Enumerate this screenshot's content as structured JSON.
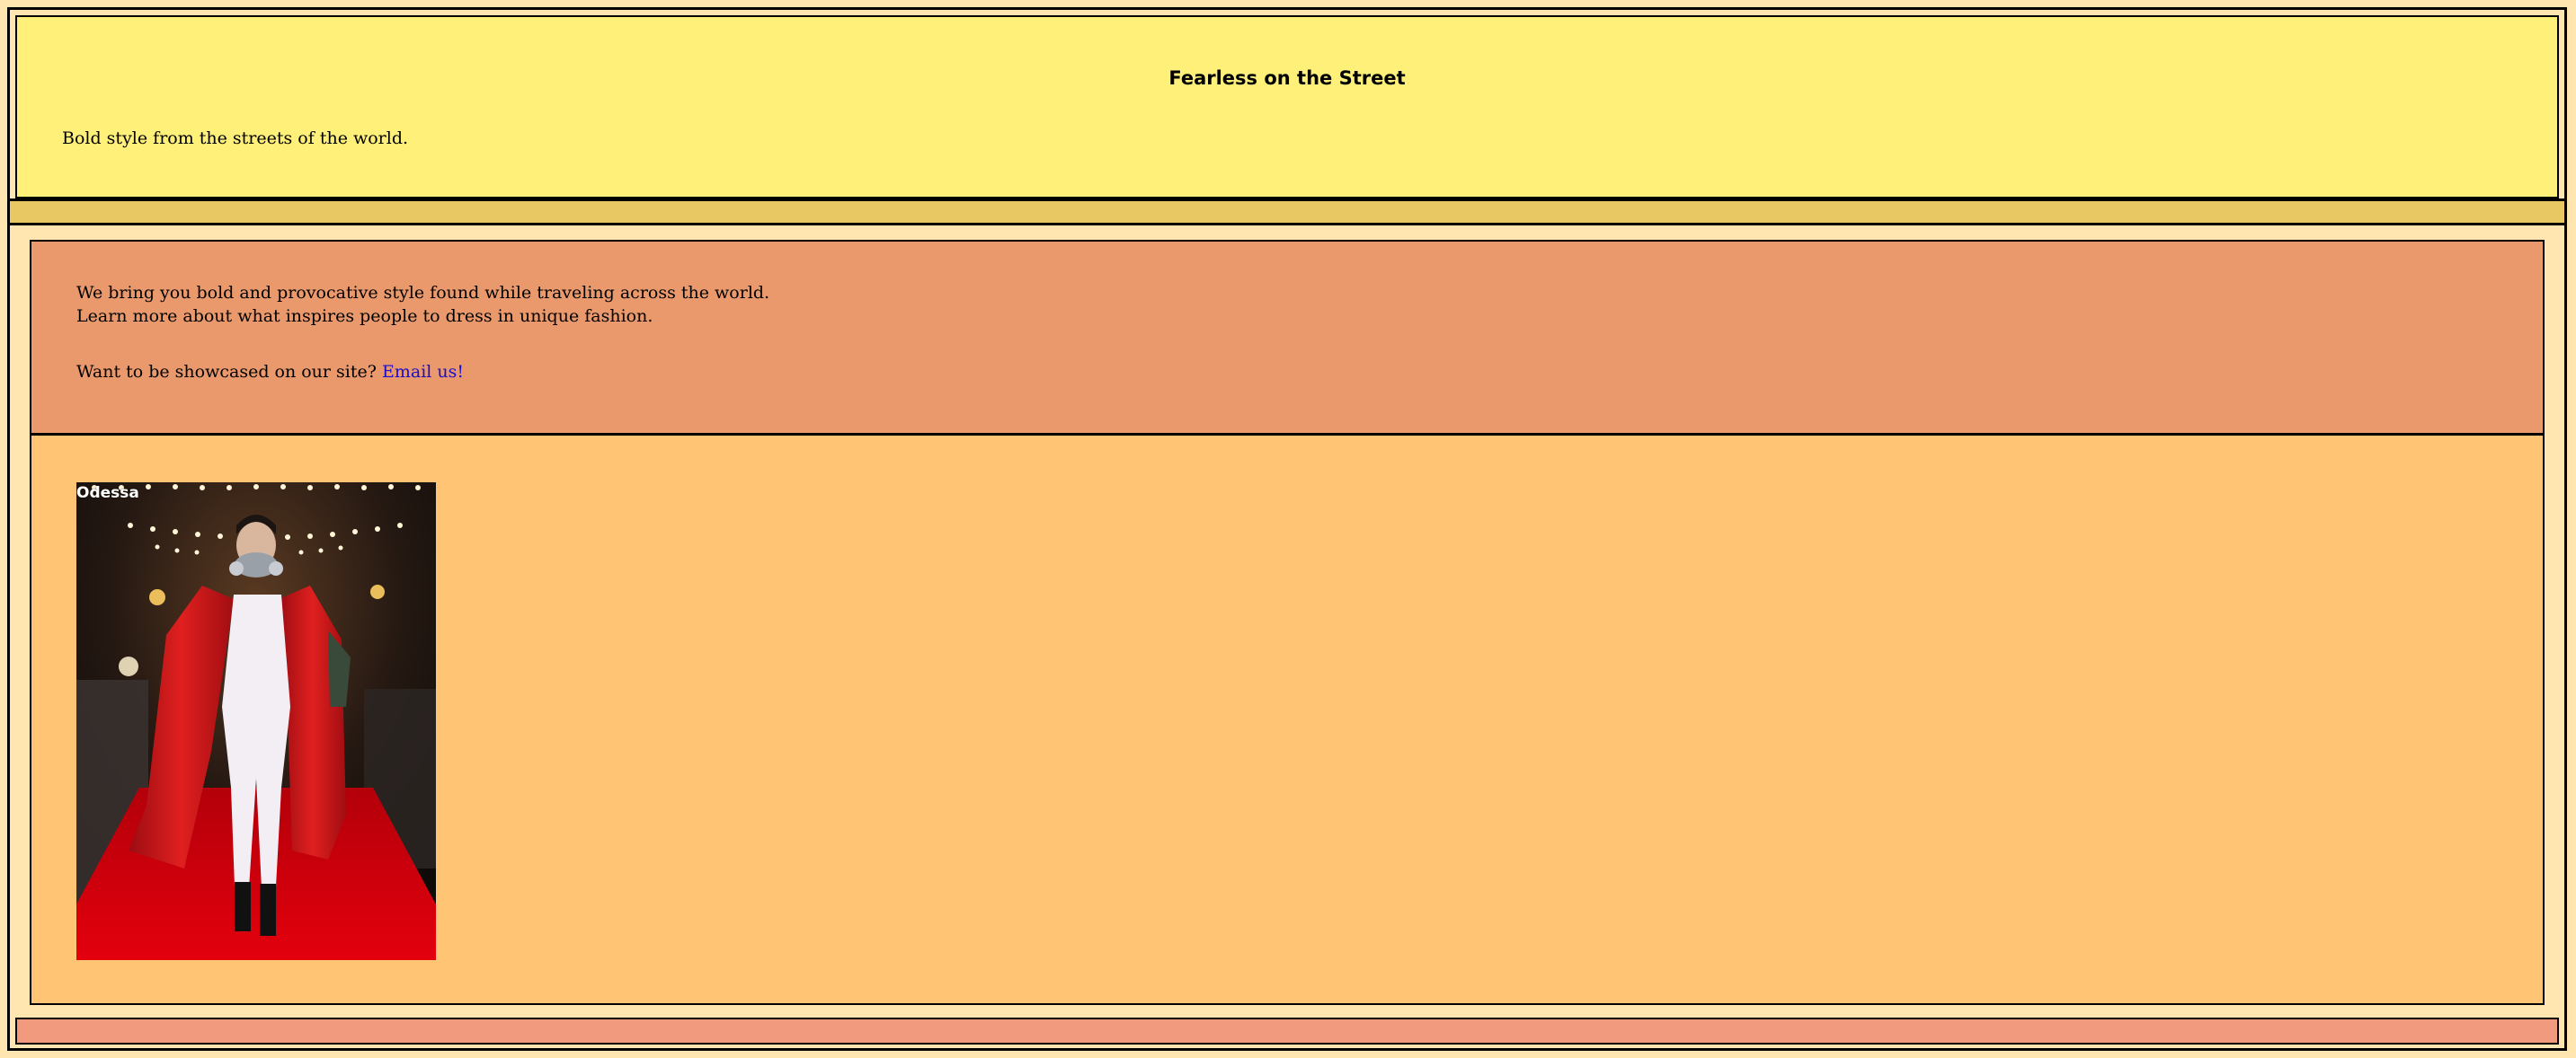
{
  "header": {
    "title": "Fearless on the Street",
    "tagline": "Bold style from the streets of the world."
  },
  "intro": {
    "line1": "We bring you bold and provocative style found while traveling across the world.",
    "line2": "Learn more about what inspires people to dress in unique fashion.",
    "showcase_prompt": "Want to be showcased on our site? ",
    "email_link": "Email us!"
  },
  "gallery": {
    "items": [
      {
        "caption": "Odessa"
      }
    ]
  },
  "colors": {
    "page_bg": "#ffe6b0",
    "header_bg": "#fff07a",
    "nav_bg": "#e8c862",
    "intro_bg": "#e9996c",
    "gallery_bg": "#ffc574",
    "footer_bg": "#f29a7e",
    "link": "#1a0dcc"
  }
}
